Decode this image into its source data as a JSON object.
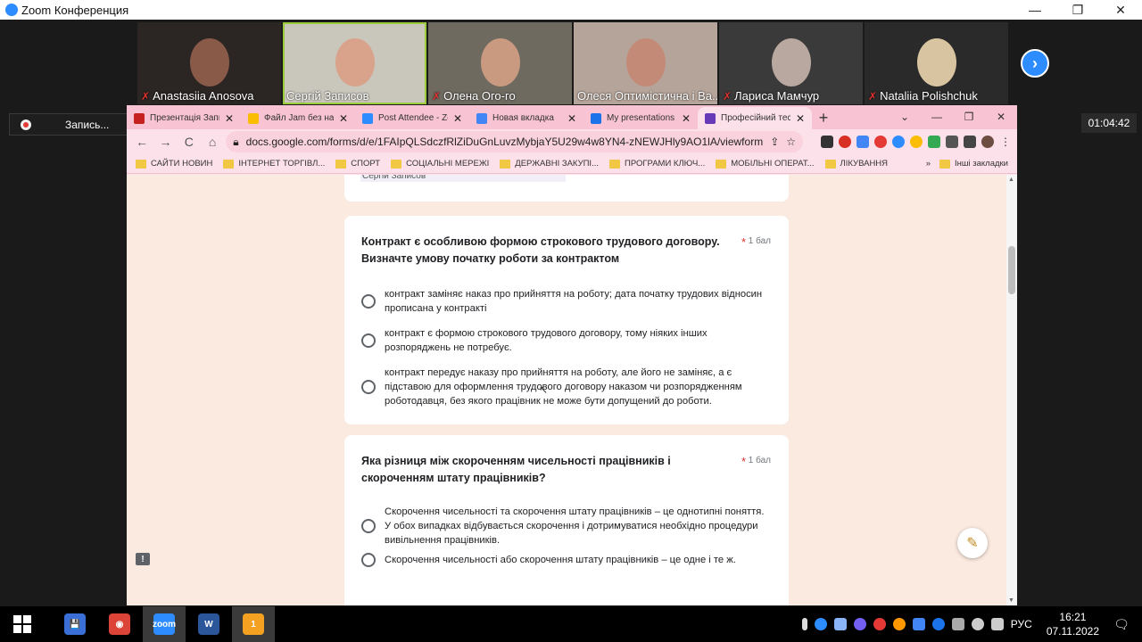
{
  "zoom": {
    "title": "Zoom Конференция",
    "controls": [
      "—",
      "❐",
      "✕"
    ],
    "next_icon": "›"
  },
  "participants": [
    {
      "name": "Anastasiia Anosova",
      "muted": true,
      "bg": "#2b2523",
      "face": "#8a5a48"
    },
    {
      "name": "Сергій Записов",
      "muted": false,
      "bg": "#c9c6bc",
      "face": "#d9a28a",
      "active": true
    },
    {
      "name": "Олена Ого-го",
      "muted": true,
      "bg": "#6e6a60",
      "face": "#c99a80"
    },
    {
      "name": "Олеся Оптимістична і Ва...",
      "muted": false,
      "bg": "#b5a49a",
      "face": "#c48a78"
    },
    {
      "name": "Лариса Мамчур",
      "muted": true,
      "bg": "#3a3a3a",
      "face": "#b8a8a0"
    },
    {
      "name": "Nataliia Polishchuk",
      "muted": true,
      "bg": "#2a2a2a",
      "face": "#d8c4a0"
    }
  ],
  "recording": {
    "label": "Запись..."
  },
  "timer": "01:04:42",
  "browser": {
    "tabs": [
      {
        "title": "Презентація Запис",
        "icon_color": "#c5221f",
        "icon": "M"
      },
      {
        "title": "Файл Jam без назв",
        "icon_color": "#fbbc04",
        "icon": "J"
      },
      {
        "title": "Post Attendee - Zo",
        "icon_color": "#2d8cff",
        "icon": "Z"
      },
      {
        "title": "Новая вкладка",
        "icon_color": "#4285f4",
        "icon": "▦"
      },
      {
        "title": "My presentations -",
        "icon_color": "#1a73e8",
        "icon": "▲"
      },
      {
        "title": "Професійний тест",
        "icon_color": "#673ab7",
        "icon": "▤",
        "active": true
      }
    ],
    "new_tab": "+",
    "window_controls": [
      "⌄",
      "—",
      "❐",
      "✕"
    ],
    "url": "docs.google.com/forms/d/e/1FAIpQLSdczfRlZiDuGnLuvzMybjaY5U29w4w8YN4-zNEWJHly9AO1lA/viewform",
    "nav": {
      "back": "←",
      "forward": "→",
      "reload": "C",
      "home": "⌂"
    },
    "bookmarks": [
      "САЙТИ НОВИН",
      "ІНТЕРНЕТ ТОРГІВЛ...",
      "СПОРТ",
      "СОЦІАЛЬНІ МЕРЕЖІ",
      "ДЕРЖАВНІ ЗАКУПІ...",
      "ПРОГРАМИ КЛЮЧ...",
      "МОБІЛЬНІ ОПЕРАТ...",
      "ЛІКУВАННЯ"
    ],
    "bookmarks_more": "»",
    "other_bookmarks": "Інші закладки"
  },
  "form": {
    "prev_answer": "Сергій Записов",
    "questions": [
      {
        "title": "Контракт є особливою формою строкового трудового договору. Визначте умову початку роботи за контрактом",
        "required": "*",
        "points": "1 бал",
        "options": [
          "контракт заміняє наказ про прийняття на роботу; дата початку трудових відносин прописана у контракті",
          "контракт є формою строкового трудового договору, тому ніяких інших розпоряджень не потребує.",
          "контракт передує наказу про прийняття на роботу, але його не заміняє, а є підставою для оформлення трудового договору наказом чи розпорядженням роботодавця, без якого працівник не може бути допущений до роботи."
        ]
      },
      {
        "title": "Яка різниця між скороченням чисельності працівників і скороченням штату працівників?",
        "required": "*",
        "points": "1 бал",
        "options": [
          "Скорочення чисельності та скорочення штату працівників – це однотипні поняття. У обох випадках відбувається скорочення і дотримуватися необхідно процедури вивільнення працівників.",
          "Скорочення чисельності або скорочення штату працівників – це одне і те ж."
        ]
      }
    ],
    "edit_icon": "✎",
    "feedback_icon": "!"
  },
  "taskbar": {
    "apps": [
      {
        "name": "save",
        "color": "#3b6fd8",
        "label": "💾"
      },
      {
        "name": "chrome",
        "color": "#db4437",
        "label": "◉"
      },
      {
        "name": "zoom",
        "color": "#2d8cff",
        "label": "zoom",
        "active": true
      },
      {
        "name": "word",
        "color": "#2b579a",
        "label": "W"
      },
      {
        "name": "viber",
        "color": "#f4a020",
        "label": "1",
        "active": true
      }
    ],
    "lang": "РУС",
    "time": "16:21",
    "date": "07.11.2022"
  }
}
